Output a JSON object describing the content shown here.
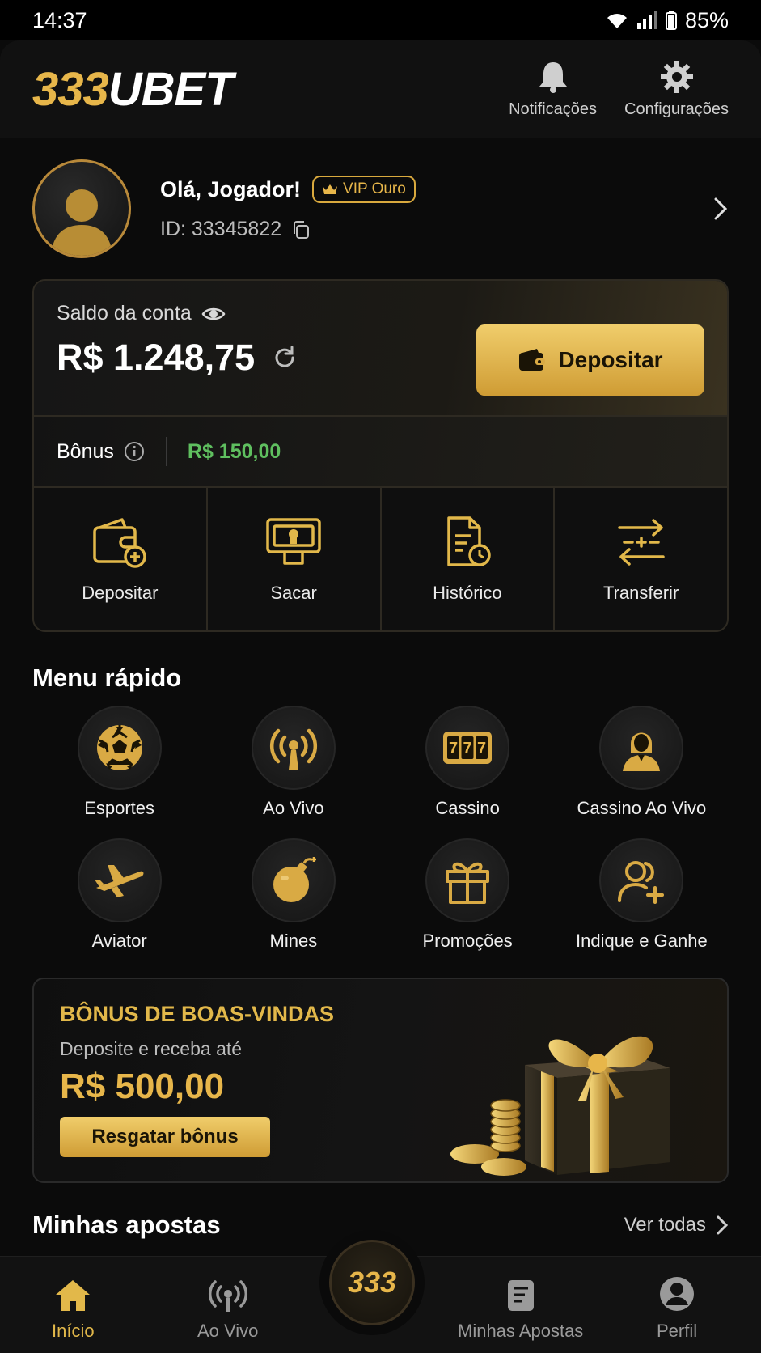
{
  "status_bar": {
    "time": "14:37",
    "battery": "85%"
  },
  "header": {
    "logo_number": "333",
    "logo_text": "UBET",
    "notifications_label": "Notificações",
    "settings_label": "Configurações"
  },
  "profile": {
    "greeting": "Olá, Jogador!",
    "vip_badge": "VIP Ouro",
    "id_text": "ID: 33345822"
  },
  "balance": {
    "label": "Saldo da conta",
    "amount": "R$ 1.248,75",
    "deposit_button": "Depositar",
    "bonus_label": "Bônus",
    "bonus_value": "R$ 150,00"
  },
  "wallet_actions": [
    {
      "label": "Depositar",
      "icon": "wallet-add-icon"
    },
    {
      "label": "Sacar",
      "icon": "atm-withdraw-icon"
    },
    {
      "label": "Histórico",
      "icon": "document-clock-icon"
    },
    {
      "label": "Transferir",
      "icon": "transfer-arrows-icon"
    }
  ],
  "quick_menu": {
    "title": "Menu rápido",
    "items": [
      {
        "label": "Esportes",
        "icon": "soccer-ball-icon"
      },
      {
        "label": "Ao Vivo",
        "icon": "live-antenna-icon"
      },
      {
        "label": "Cassino",
        "icon": "slot-777-icon"
      },
      {
        "label": "Cassino Ao Vivo",
        "icon": "dealer-icon"
      },
      {
        "label": "Aviator",
        "icon": "airplane-icon"
      },
      {
        "label": "Mines",
        "icon": "bomb-icon"
      },
      {
        "label": "Promoções",
        "icon": "gift-icon"
      },
      {
        "label": "Indique e Ganhe",
        "icon": "user-plus-icon"
      }
    ]
  },
  "promo": {
    "title": "BÔNUS DE BOAS-VINDAS",
    "subtitle": "Deposite e receba até",
    "amount": "R$ 500,00",
    "button": "Resgatar bônus"
  },
  "bets": {
    "title": "Minhas apostas",
    "see_all": "Ver todas"
  },
  "bottom_nav": {
    "home": "Início",
    "live": "Ao Vivo",
    "center": "333",
    "my_bets": "Minhas Apostas",
    "profile": "Perfil"
  },
  "colors": {
    "accent": "#e2b84a",
    "bonus_green": "#5fbf5f",
    "background": "#0b0b0b"
  }
}
